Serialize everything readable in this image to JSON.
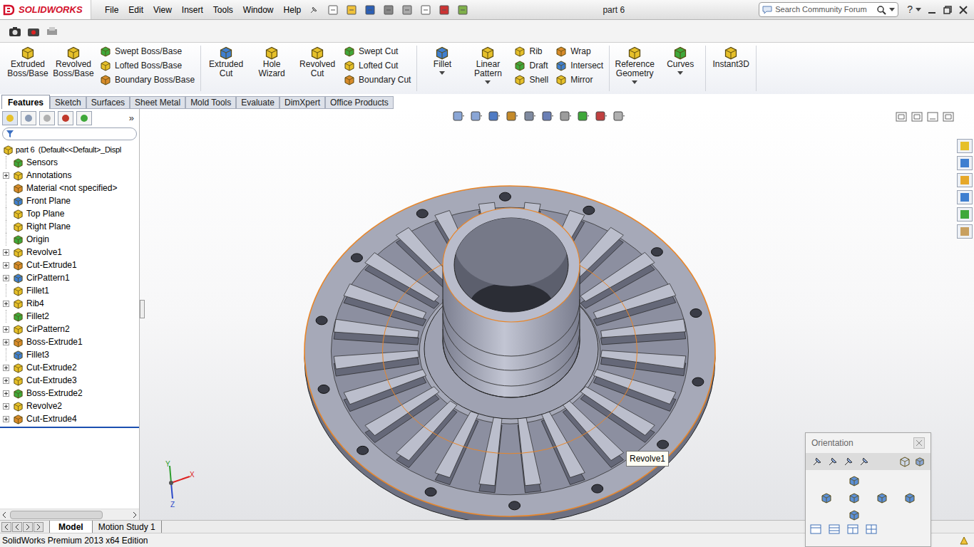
{
  "app": {
    "logo": "SOLIDWORKS"
  },
  "window": {
    "title": "part 6"
  },
  "menu": [
    "File",
    "Edit",
    "View",
    "Insert",
    "Tools",
    "Window",
    "Help"
  ],
  "search": {
    "placeholder": "Search Community Forum"
  },
  "help_button": "?",
  "ribbon": [
    {
      "columns": [
        {
          "kind": "large",
          "label": "Extruded Boss/Base",
          "dropdown": false
        },
        {
          "kind": "large",
          "label": "Revolved Boss/Base",
          "dropdown": false
        },
        {
          "kind": "stack",
          "items": [
            "Swept Boss/Base",
            "Lofted Boss/Base",
            "Boundary Boss/Base"
          ]
        }
      ]
    },
    {
      "columns": [
        {
          "kind": "large",
          "label": "Extruded Cut",
          "dropdown": false
        },
        {
          "kind": "large",
          "label": "Hole Wizard",
          "dropdown": false
        },
        {
          "kind": "large",
          "label": "Revolved Cut",
          "dropdown": false
        },
        {
          "kind": "stack",
          "items": [
            "Swept Cut",
            "Lofted Cut",
            "Boundary Cut"
          ]
        }
      ]
    },
    {
      "columns": [
        {
          "kind": "large",
          "label": "Fillet",
          "dropdown": true
        },
        {
          "kind": "large",
          "label": "Linear Pattern",
          "dropdown": true
        },
        {
          "kind": "stack",
          "items": [
            "Rib",
            "Draft",
            "Shell"
          ]
        },
        {
          "kind": "stack",
          "items": [
            "Wrap",
            "Intersect",
            "Mirror"
          ]
        }
      ]
    },
    {
      "columns": [
        {
          "kind": "large",
          "label": "Reference Geometry",
          "dropdown": true
        },
        {
          "kind": "large",
          "label": "Curves",
          "dropdown": true
        }
      ]
    },
    {
      "columns": [
        {
          "kind": "large",
          "label": "Instant3D",
          "dropdown": false
        }
      ]
    }
  ],
  "command_tabs": [
    {
      "label": "Features",
      "selected": true
    },
    {
      "label": "Sketch",
      "selected": false
    },
    {
      "label": "Surfaces",
      "selected": false
    },
    {
      "label": "Sheet Metal",
      "selected": false
    },
    {
      "label": "Mold Tools",
      "selected": false
    },
    {
      "label": "Evaluate",
      "selected": false
    },
    {
      "label": "DimXpert",
      "selected": false
    },
    {
      "label": "Office Products",
      "selected": false
    }
  ],
  "feature_tree": {
    "more": "»",
    "root": "part 6  (Default<<Default>_Displ",
    "items": [
      {
        "label": "Sensors",
        "expandable": false
      },
      {
        "label": "Annotations",
        "expandable": true
      },
      {
        "label": "Material <not specified>",
        "expandable": false
      },
      {
        "label": "Front Plane",
        "expandable": false
      },
      {
        "label": "Top Plane",
        "expandable": false
      },
      {
        "label": "Right Plane",
        "expandable": false
      },
      {
        "label": "Origin",
        "expandable": false
      },
      {
        "label": "Revolve1",
        "expandable": true
      },
      {
        "label": "Cut-Extrude1",
        "expandable": true
      },
      {
        "label": "CirPattern1",
        "expandable": true
      },
      {
        "label": "Fillet1",
        "expandable": false
      },
      {
        "label": "Rib4",
        "expandable": true
      },
      {
        "label": "Fillet2",
        "expandable": false
      },
      {
        "label": "CirPattern2",
        "expandable": true
      },
      {
        "label": "Boss-Extrude1",
        "expandable": true
      },
      {
        "label": "Fillet3",
        "expandable": false
      },
      {
        "label": "Cut-Extrude2",
        "expandable": true
      },
      {
        "label": "Cut-Extrude3",
        "expandable": true
      },
      {
        "label": "Boss-Extrude2",
        "expandable": true
      },
      {
        "label": "Revolve2",
        "expandable": true
      },
      {
        "label": "Cut-Extrude4",
        "expandable": true
      }
    ]
  },
  "bottom_tabs": [
    {
      "label": "Model",
      "selected": true
    },
    {
      "label": "Motion Study 1",
      "selected": false
    }
  ],
  "status_bar": {
    "text": "SolidWorks Premium 2013 x64 Edition"
  },
  "tooltip": {
    "text": "Revolve1"
  },
  "orientation": {
    "title": "Orientation"
  },
  "triad": {
    "x": "X",
    "y": "Y",
    "z": "Z"
  }
}
